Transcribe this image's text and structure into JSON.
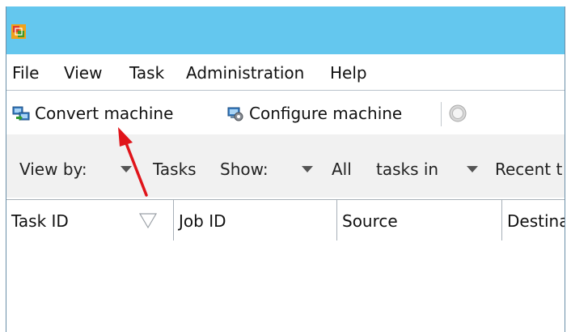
{
  "window": {
    "app_icon": "vmware-converter-icon"
  },
  "menu": {
    "items": [
      "File",
      "View",
      "Task",
      "Administration",
      "Help"
    ]
  },
  "toolbar": {
    "convert_label": "Convert machine",
    "convert_icon": "convert-machine-icon",
    "configure_label": "Configure machine",
    "configure_icon": "configure-machine-icon",
    "stop_icon": "stop-icon"
  },
  "filter": {
    "view_by_label": "View by:",
    "view_by_value": "Tasks",
    "show_label": "Show:",
    "show_value": "All",
    "tasks_in_label": "tasks in",
    "tasks_in_value": "Recent t"
  },
  "table": {
    "columns": [
      "Task ID",
      "Job ID",
      "Source",
      "Destina"
    ]
  },
  "annotation": {
    "arrow_color": "#e0141a"
  }
}
